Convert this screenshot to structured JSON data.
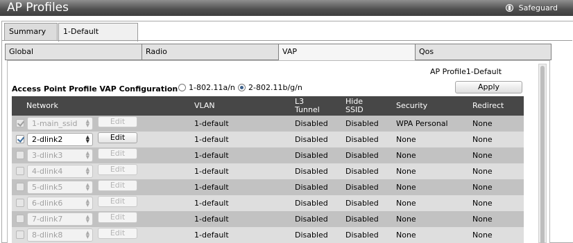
{
  "header": {
    "title": "AP Profiles",
    "safeguard": "Safeguard"
  },
  "top_tabs": [
    "Summary",
    "1-Default"
  ],
  "sub_tabs": [
    "Global",
    "Radio",
    "VAP",
    "Qos"
  ],
  "profile_label": "AP Profile1-Default",
  "apply_label": "Apply",
  "config": {
    "label": "Access Point Profile VAP Configuration :",
    "options": [
      "1-802.11a/n",
      "2-802.11b/g/n"
    ],
    "selected": "2-802.11b/g/n"
  },
  "table": {
    "headers": {
      "network": "Network",
      "vlan": "VLAN",
      "l3_tunnel": "L3\nTunnel",
      "hide_ssid": "Hide\nSSID",
      "security": "Security",
      "redirect": "Redirect"
    },
    "edit_label": "Edit",
    "rows": [
      {
        "checked": true,
        "enabled": false,
        "network": "1-main_ssid",
        "vlan": "1-default",
        "l3": "Disabled",
        "hide": "Disabled",
        "security": "WPA Personal",
        "redirect": "None"
      },
      {
        "checked": true,
        "enabled": true,
        "network": "2-dlink2",
        "vlan": "1-default",
        "l3": "Disabled",
        "hide": "Disabled",
        "security": "None",
        "redirect": "None"
      },
      {
        "checked": false,
        "enabled": false,
        "network": "3-dlink3",
        "vlan": "1-default",
        "l3": "Disabled",
        "hide": "Disabled",
        "security": "None",
        "redirect": "None"
      },
      {
        "checked": false,
        "enabled": false,
        "network": "4-dlink4",
        "vlan": "1-default",
        "l3": "Disabled",
        "hide": "Disabled",
        "security": "None",
        "redirect": "None"
      },
      {
        "checked": false,
        "enabled": false,
        "network": "5-dlink5",
        "vlan": "1-default",
        "l3": "Disabled",
        "hide": "Disabled",
        "security": "None",
        "redirect": "None"
      },
      {
        "checked": false,
        "enabled": false,
        "network": "6-dlink6",
        "vlan": "1-default",
        "l3": "Disabled",
        "hide": "Disabled",
        "security": "None",
        "redirect": "None"
      },
      {
        "checked": false,
        "enabled": false,
        "network": "7-dlink7",
        "vlan": "1-default",
        "l3": "Disabled",
        "hide": "Disabled",
        "security": "None",
        "redirect": "None"
      },
      {
        "checked": false,
        "enabled": false,
        "network": "8-dlink8",
        "vlan": "1-default",
        "l3": "Disabled",
        "hide": "Disabled",
        "security": "None",
        "redirect": "None"
      }
    ]
  }
}
